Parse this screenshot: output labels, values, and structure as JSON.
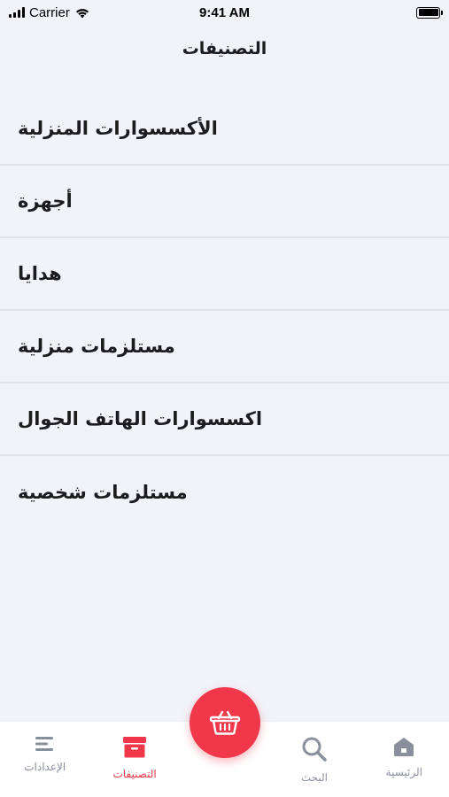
{
  "status_bar": {
    "carrier": "Carrier",
    "time": "9:41 AM",
    "battery_level": 1.0
  },
  "header": {
    "title": "التصنيفات"
  },
  "categories": [
    {
      "label": "الأكسسوارات المنزلية"
    },
    {
      "label": "أجهزة"
    },
    {
      "label": "هدايا"
    },
    {
      "label": "مستلزمات منزلية"
    },
    {
      "label": "اكسسوارات الهاتف الجوال"
    },
    {
      "label": "مستلزمات شخصية"
    }
  ],
  "tab_bar": {
    "tabs": [
      {
        "label": "الإعدادات",
        "icon": "menu-lines-icon",
        "active": false
      },
      {
        "label": "التصنيفات",
        "icon": "archive-box-icon",
        "active": true
      },
      {
        "label": "البحث",
        "icon": "search-icon",
        "active": false
      },
      {
        "label": "الرئيسية",
        "icon": "home-icon",
        "active": false
      }
    ],
    "center_button_icon": "basket-icon"
  },
  "colors": {
    "accent": "#f0384a",
    "background": "#f1f3f8",
    "inactive": "#8a8f9c"
  }
}
